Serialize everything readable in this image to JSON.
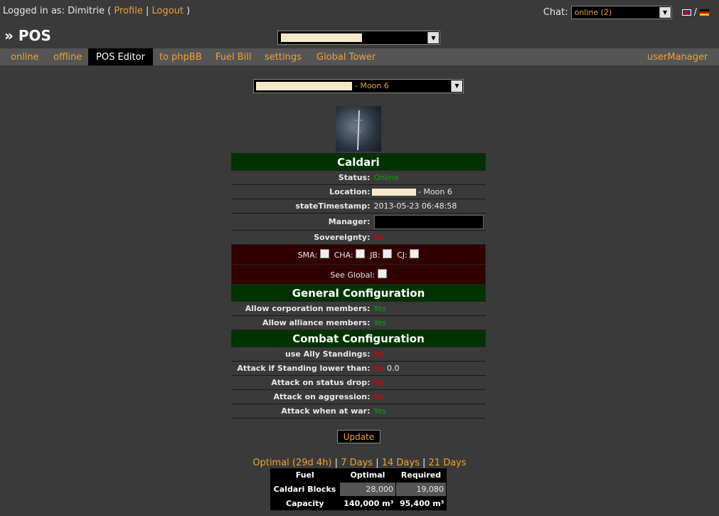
{
  "header": {
    "logged_in_prefix": "Logged in as: Dimitrie (",
    "profile": "Profile",
    "sep": "|",
    "logout": "Logout",
    "close": ")",
    "chat_label": "Chat:",
    "chat_value": "online (2)",
    "lang_sep": "/"
  },
  "page_title": "» POS",
  "nav": [
    "online",
    "offline",
    "POS Editor",
    "to phpBB",
    "Fuel Bill",
    "settings",
    "Global Tower",
    "userManager"
  ],
  "moon_select_suffix": "- Moon 6",
  "tower": {
    "race": "Caldari",
    "status_label": "Status:",
    "status_value": "Online",
    "location_label": "Location:",
    "location_value": "- Moon 6",
    "timestamp_label": "stateTimestamp:",
    "timestamp_value": "2013-05-23 06:48:58",
    "manager_label": "Manager:",
    "manager_value": "",
    "sovereignty_label": "Sovereignty:",
    "sovereignty_value": "No",
    "roles": [
      "SMA:",
      "CHA:",
      "JB:",
      "CJ:"
    ],
    "see_global": "See Global:"
  },
  "general": {
    "title": "General Configuration",
    "rows": [
      {
        "label": "Allow corporation members:",
        "value": "Yes"
      },
      {
        "label": "Allow alliance members:",
        "value": "Yes"
      }
    ]
  },
  "combat": {
    "title": "Combat Configuration",
    "rows": [
      {
        "label": "use Ally Standings:",
        "value": "No"
      },
      {
        "label": "Attack if Standing lower than:",
        "value": "No",
        "extra": "0.0"
      },
      {
        "label": "Attack on status drop:",
        "value": "No"
      },
      {
        "label": "Attack on aggression:",
        "value": "No"
      },
      {
        "label": "Attack when at war:",
        "value": "Yes"
      }
    ]
  },
  "update_label": "Update",
  "periods": {
    "optimal": "Optimal (29d 4h)",
    "d7": "7 Days",
    "d14": "14 Days",
    "d21": "21 Days",
    "sep": "|"
  },
  "fuel_table": {
    "headers": [
      "Fuel",
      "Optimal",
      "Required"
    ],
    "rows": [
      {
        "label": "Caldari Blocks",
        "optimal": "28,000",
        "required": "19,080"
      },
      {
        "label": "Capacity",
        "optimal": "140,000 m³",
        "required": "95,400 m³"
      }
    ]
  },
  "colors": {
    "accent": "#f0a030",
    "yes": "#00aa00",
    "no": "#dd0000",
    "header_green": "#003300",
    "role_red": "#330000"
  }
}
